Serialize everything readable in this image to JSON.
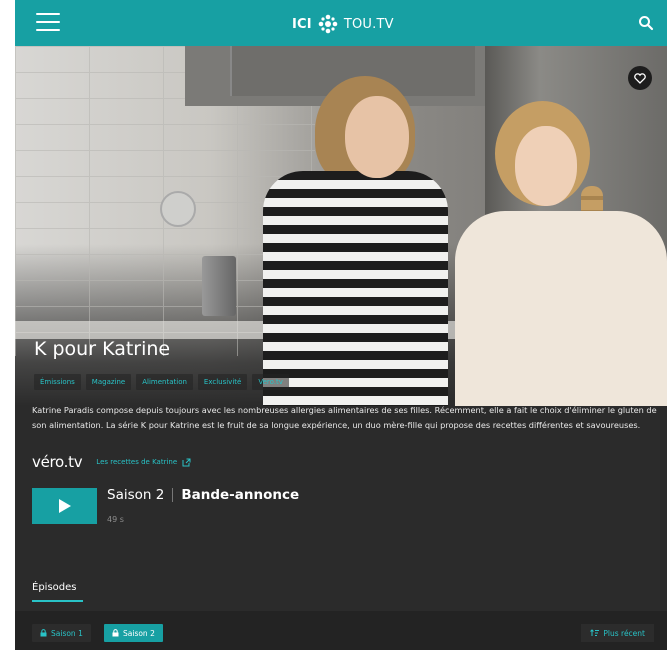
{
  "header": {
    "brand_ici": "ICI",
    "brand_toutv": "TOU.TV",
    "menu_icon": "hamburger-icon",
    "search_icon": "search-icon"
  },
  "hero": {
    "title": "K pour Katrine",
    "favorite_icon": "heart-icon",
    "tags": [
      "Émissions",
      "Magazine",
      "Alimentation",
      "Exclusivité",
      "Vero.tv"
    ]
  },
  "description": "Katrine Paradis compose depuis toujours avec les nombreuses allergies alimentaires de ses filles. Récemment, elle a fait le choix d'éliminer le gluten de son alimentation. La série K pour Katrine est le fruit de sa longue expérience, un duo mère-fille qui propose des recettes différentes et savoureuses.",
  "brand": {
    "logo_text": "véro.tv",
    "link_label": "Les recettes de Katrine",
    "link_icon": "external-link-icon"
  },
  "trailer": {
    "play_icon": "play-icon",
    "season": "Saison 2",
    "label": "Bande-annonce",
    "duration": "49 s"
  },
  "episodes": {
    "tab_label": "Épisodes",
    "seasons": [
      {
        "label": "Saison 1",
        "selected": false,
        "icon": "lock-icon"
      },
      {
        "label": "Saison 2",
        "selected": true,
        "icon": "lock-icon"
      }
    ],
    "sort_label": "Plus récent",
    "sort_icon": "sort-icon"
  },
  "colors": {
    "accent": "#17a0a3",
    "accent_text": "#29c3c7",
    "background": "#2b2b2b"
  }
}
